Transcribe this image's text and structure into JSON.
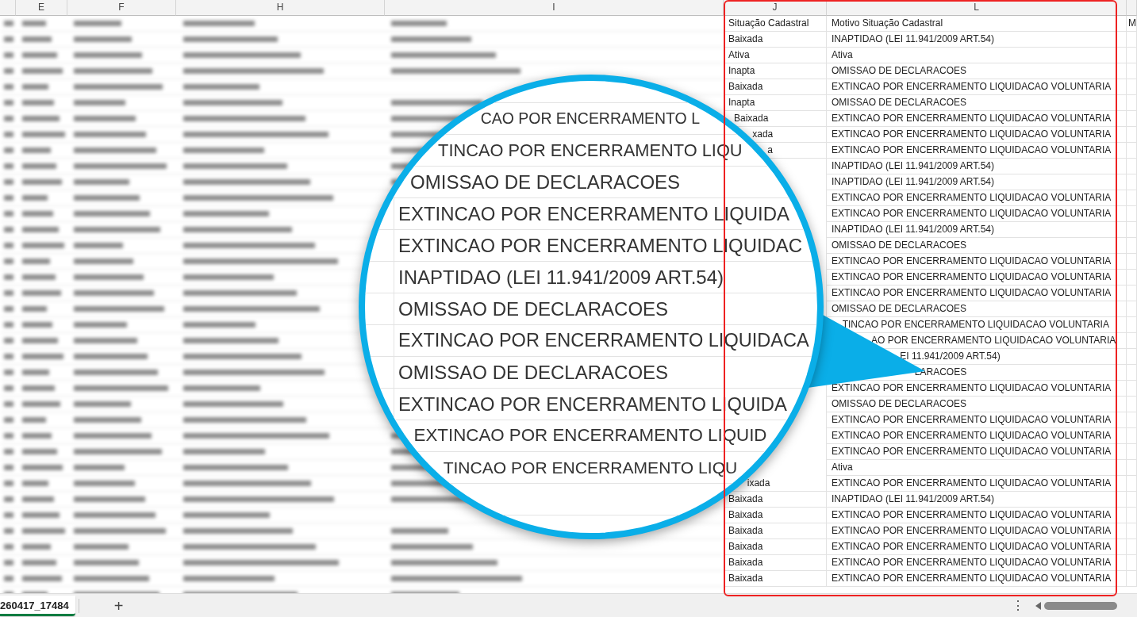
{
  "column_headers": [
    {
      "label": "E"
    },
    {
      "label": "F"
    },
    {
      "label": "H"
    },
    {
      "label": "I"
    },
    {
      "label": "J"
    },
    {
      "label": "L"
    }
  ],
  "rows": [
    {
      "status": "Situação Cadastral",
      "reason": "Motivo Situação Cadastral",
      "column_m": "M"
    },
    {
      "status": "Baixada",
      "reason": "INAPTIDAO (LEI 11.941/2009 ART.54)"
    },
    {
      "status": "Ativa",
      "reason": "Ativa"
    },
    {
      "status": "Inapta",
      "reason": "OMISSAO DE DECLARACOES"
    },
    {
      "status": "Baixada",
      "reason": "EXTINCAO POR ENCERRAMENTO LIQUIDACAO VOLUNTARIA"
    },
    {
      "status": "Inapta",
      "reason": "OMISSAO DE DECLARACOES"
    },
    {
      "status": "Baixada",
      "reason": "EXTINCAO POR ENCERRAMENTO LIQUIDACAO VOLUNTARIA"
    },
    {
      "status": "xada",
      "reason": "EXTINCAO POR ENCERRAMENTO LIQUIDACAO VOLUNTARIA"
    },
    {
      "status": "a",
      "reason": "EXTINCAO POR ENCERRAMENTO LIQUIDACAO VOLUNTARIA"
    },
    {
      "reason": "INAPTIDAO (LEI 11.941/2009 ART.54)"
    },
    {
      "reason": "INAPTIDAO (LEI 11.941/2009 ART.54)"
    },
    {
      "reason": "EXTINCAO POR ENCERRAMENTO LIQUIDACAO VOLUNTARIA"
    },
    {
      "reason": "EXTINCAO POR ENCERRAMENTO LIQUIDACAO VOLUNTARIA"
    },
    {
      "reason": "INAPTIDAO (LEI 11.941/2009 ART.54)"
    },
    {
      "reason": "OMISSAO DE DECLARACOES"
    },
    {
      "reason": "EXTINCAO POR ENCERRAMENTO LIQUIDACAO VOLUNTARIA"
    },
    {
      "reason": "EXTINCAO POR ENCERRAMENTO LIQUIDACAO VOLUNTARIA"
    },
    {
      "reason": "EXTINCAO POR ENCERRAMENTO LIQUIDACAO VOLUNTARIA"
    },
    {
      "reason": "OMISSAO DE DECLARACOES"
    },
    {
      "reason": "TINCAO POR ENCERRAMENTO LIQUIDACAO VOLUNTARIA"
    },
    {
      "reason": "AO POR ENCERRAMENTO LIQUIDACAO VOLUNTARIA"
    },
    {
      "reason": "EI 11.941/2009 ART.54)"
    },
    {
      "reason": "LARACOES"
    },
    {
      "reason": "EXTINCAO POR ENCERRAMENTO LIQUIDACAO VOLUNTARIA"
    },
    {
      "reason": "OMISSAO DE DECLARACOES"
    },
    {
      "reason": "EXTINCAO POR ENCERRAMENTO LIQUIDACAO VOLUNTARIA"
    },
    {
      "reason": "EXTINCAO POR ENCERRAMENTO LIQUIDACAO VOLUNTARIA"
    },
    {
      "reason": "EXTINCAO POR ENCERRAMENTO LIQUIDACAO VOLUNTARIA"
    },
    {
      "reason": "Ativa"
    },
    {
      "status": "ixada",
      "reason": "EXTINCAO POR ENCERRAMENTO LIQUIDACAO VOLUNTARIA"
    },
    {
      "status": "Baixada",
      "reason": "INAPTIDAO (LEI 11.941/2009 ART.54)"
    },
    {
      "status": "Baixada",
      "reason": "EXTINCAO POR ENCERRAMENTO LIQUIDACAO VOLUNTARIA"
    },
    {
      "status": "Baixada",
      "reason": "EXTINCAO POR ENCERRAMENTO LIQUIDACAO VOLUNTARIA"
    },
    {
      "status": "Baixada",
      "reason": "EXTINCAO POR ENCERRAMENTO LIQUIDACAO VOLUNTARIA"
    },
    {
      "status": "Baixada",
      "reason": "EXTINCAO POR ENCERRAMENTO LIQUIDACAO VOLUNTARIA"
    },
    {
      "status": "Baixada",
      "reason": "EXTINCAO POR ENCERRAMENTO LIQUIDACAO VOLUNTARIA"
    }
  ],
  "magnifier": {
    "rows": [
      {
        "text": "CAO POR ENCERRAMENTO L"
      },
      {
        "text": "TINCAO POR ENCERRAMENTO LIQU"
      },
      {
        "text": "OMISSAO DE DECLARACOES"
      },
      {
        "text": "EXTINCAO POR ENCERRAMENTO LIQUIDA"
      },
      {
        "text": "EXTINCAO POR ENCERRAMENTO LIQUIDAC"
      },
      {
        "text": "INAPTIDAO (LEI 11.941/2009 ART.54)"
      },
      {
        "text": "OMISSAO DE DECLARACOES"
      },
      {
        "text": "EXTINCAO POR ENCERRAMENTO LIQUIDACA"
      },
      {
        "text": "OMISSAO DE DECLARACOES"
      },
      {
        "text": "EXTINCAO POR ENCERRAMENTO LIQUIDA"
      },
      {
        "text": "EXTINCAO POR ENCERRAMENTO LIQUID"
      },
      {
        "text": "TINCAO POR ENCERRAMENTO LIQU"
      }
    ]
  },
  "sheet_tabs": [
    {
      "label": "260417_17484",
      "selected": true
    }
  ],
  "add_sheet": "+",
  "more": "⋮"
}
